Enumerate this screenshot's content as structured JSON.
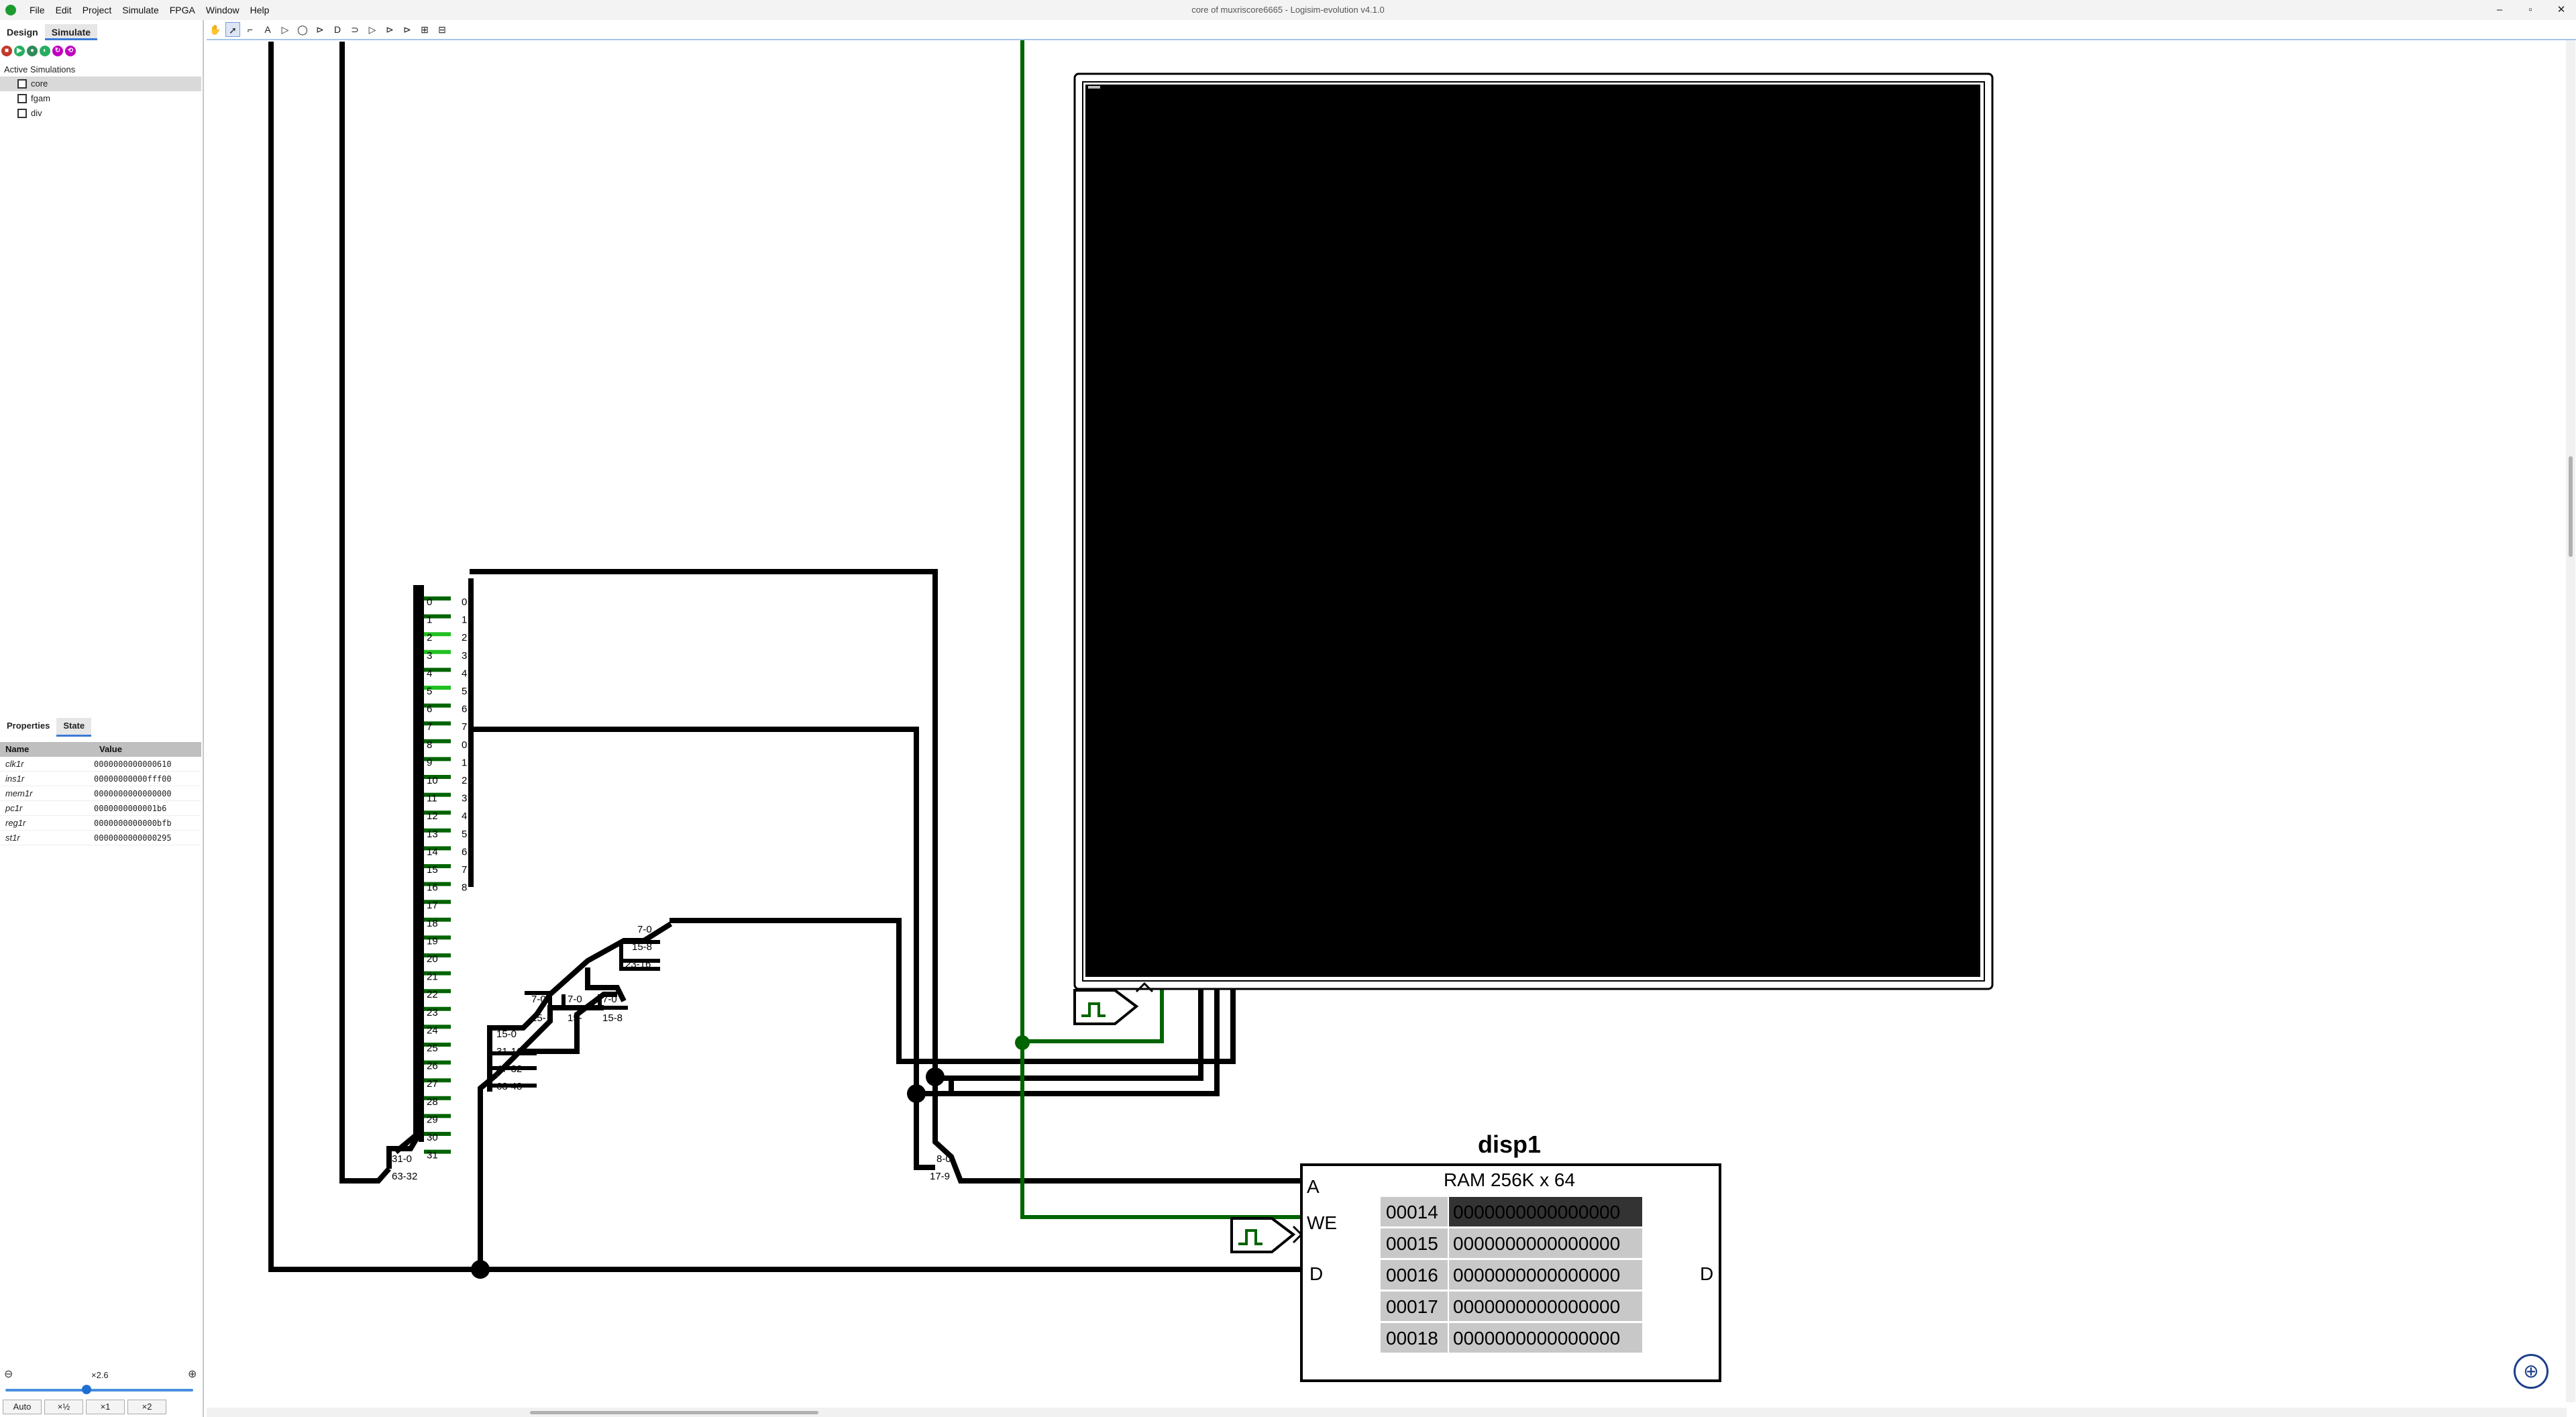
{
  "window": {
    "title": "core of muxriscore6665 - Logisim-evolution v4.1.0",
    "minimize": "–",
    "maximize": "▫",
    "close": "✕"
  },
  "menu": [
    "File",
    "Edit",
    "Project",
    "Simulate",
    "FPGA",
    "Window",
    "Help"
  ],
  "left_tabs": {
    "design": "Design",
    "simulate": "Simulate"
  },
  "active_simulations": {
    "label": "Active Simulations",
    "items": [
      "core",
      "fgam",
      "div"
    ],
    "selected": "core"
  },
  "properties": {
    "tabs": {
      "properties": "Properties",
      "state": "State"
    },
    "header": {
      "name": "Name",
      "value": "Value"
    },
    "rows": [
      {
        "name": "clk1r",
        "value": "0000000000000610"
      },
      {
        "name": "ins1r",
        "value": "00000000000fff00"
      },
      {
        "name": "mem1r",
        "value": "0000000000000000"
      },
      {
        "name": "pc1r",
        "value": "0000000000001b6"
      },
      {
        "name": "reg1r",
        "value": "0000000000000bfb"
      },
      {
        "name": "st1r",
        "value": "0000000000000295"
      }
    ]
  },
  "zoom": {
    "value": "×2.6",
    "buttons": [
      "Auto",
      "×½",
      "×1",
      "×2"
    ]
  },
  "circuit": {
    "splitter_left": {
      "top": "31-0",
      "bottom": "63-32"
    },
    "splitter_main_labels": [
      "0",
      "1",
      "2",
      "3",
      "4",
      "5",
      "6",
      "7",
      "8",
      "9",
      "10",
      "11",
      "12",
      "13",
      "14",
      "15",
      "16",
      "17",
      "18",
      "19",
      "20",
      "21",
      "22",
      "23",
      "24",
      "25",
      "26",
      "27",
      "28",
      "29",
      "30",
      "31"
    ],
    "splitter_right_labels": [
      "0",
      "1",
      "2",
      "3",
      "4",
      "5",
      "6",
      "7",
      "0",
      "1",
      "2",
      "3",
      "4",
      "5",
      "6",
      "7",
      "8"
    ],
    "split_labels_a": [
      "7-0",
      "15-8",
      "23-16"
    ],
    "split_labels_b": [
      "7-0",
      "7-0",
      "7-0"
    ],
    "split_labels_b2": [
      "15-",
      "15-",
      "15-8"
    ],
    "split_labels_c": [
      "15-0",
      "31-16",
      "47-32",
      "63-48"
    ],
    "split_addr": {
      "top": "8-0",
      "bottom": "17-9"
    },
    "ram": {
      "name": "disp1",
      "type_label": "RAM 256K x 64",
      "pin_a": "A",
      "pin_we": "WE",
      "pin_d": "D",
      "pin_dout": "D",
      "rows": [
        {
          "addr": "00014",
          "value": "0000000000000000",
          "highlight": true
        },
        {
          "addr": "00015",
          "value": "0000000000000000",
          "highlight": false
        },
        {
          "addr": "00016",
          "value": "0000000000000000",
          "highlight": false
        },
        {
          "addr": "00017",
          "value": "0000000000000000",
          "highlight": false
        },
        {
          "addr": "00018",
          "value": "0000000000000000",
          "highlight": false
        }
      ]
    }
  },
  "colors": {
    "wire": "#000000",
    "wire_active": "#006400",
    "wire_bright": "#22c022",
    "screen_bg": "#000000",
    "ram_cell_bg": "#c8c8c8",
    "ram_highlight_bg": "#333333"
  },
  "icons": {
    "app": "logisim-app-icon",
    "navigate": "navigate-crosshair-icon",
    "zoom_out": "zoom-out-icon",
    "zoom_in": "zoom-in-icon"
  }
}
